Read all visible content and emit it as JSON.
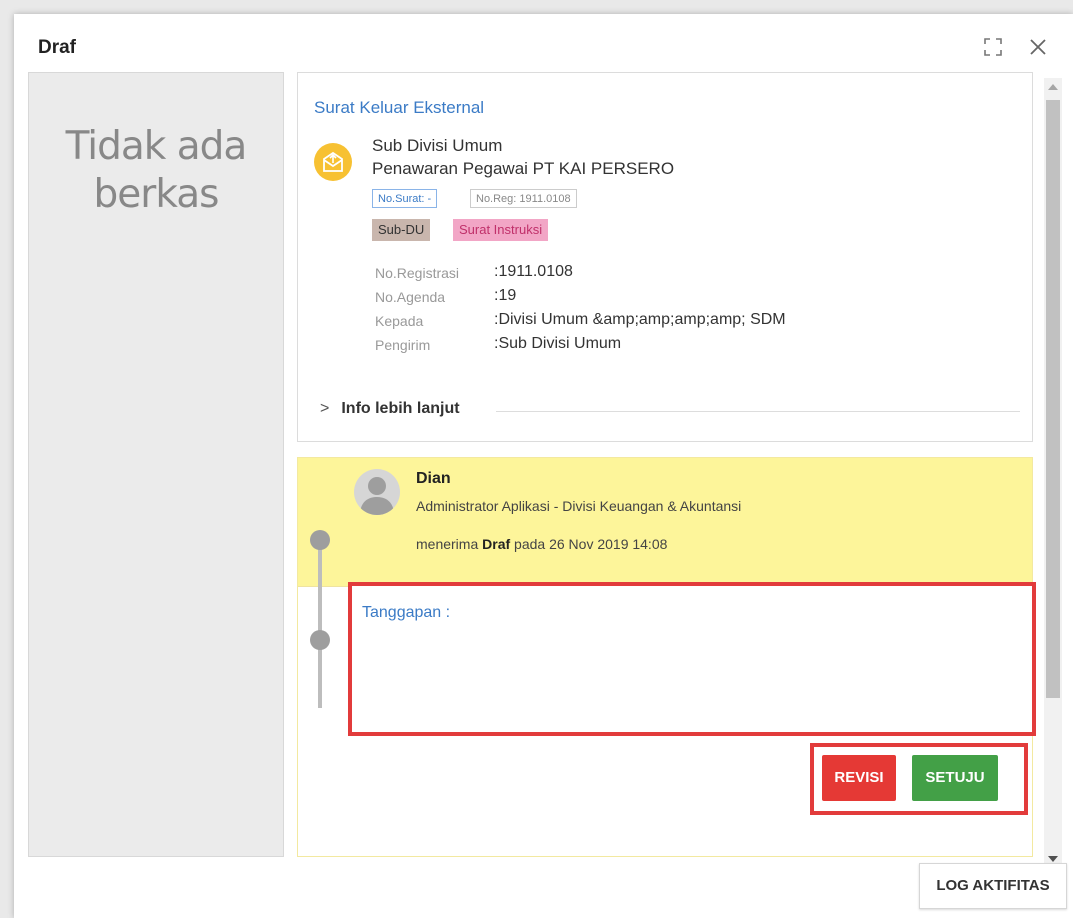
{
  "dialog": {
    "title": "Draf"
  },
  "left_panel": {
    "line1": "Tidak ada",
    "line2": "berkas"
  },
  "card": {
    "type": "Surat Keluar Eksternal",
    "unit": "Sub Divisi Umum",
    "subject": "Penawaran Pegawai PT KAI PERSERO",
    "no_surat_chip": "No.Surat: -",
    "no_reg_chip": "No.Reg: 1911.0108",
    "tags": [
      "Sub-DU",
      "Surat Instruksi"
    ],
    "info": [
      {
        "label": "No.Registrasi",
        "value": ":1911.0108"
      },
      {
        "label": "No.Agenda",
        "value": ":19"
      },
      {
        "label": "Kepada",
        "value": ":Divisi Umum &amp;amp;amp;amp; SDM"
      },
      {
        "label": "Pengirim",
        "value": ":Sub Divisi Umum"
      }
    ],
    "more_label": "Info lebih lanjut"
  },
  "timeline": {
    "name": "Dian",
    "role": "Administrator Aplikasi - Divisi Keuangan & Akuntansi",
    "action_prefix": "menerima",
    "action_item": "Draf",
    "action_suffix": "pada 26 Nov 2019 14:08",
    "response_label": "Tanggapan :"
  },
  "buttons": {
    "revisi": "REVISI",
    "setuju": "SETUJU",
    "log": "LOG AKTIFITAS"
  },
  "colors": {
    "accent_blue": "#3b7bc6",
    "revisi_red": "#e53935",
    "setuju_green": "#43a047",
    "highlight_yellow": "#fdf59a",
    "annotation_red": "#e23b3b"
  },
  "icons": {
    "maximize": "maximize-icon",
    "close": "close-icon",
    "envelope": "envelope-icon",
    "avatar": "user-avatar-icon",
    "chevron": "chevron-right-icon"
  }
}
